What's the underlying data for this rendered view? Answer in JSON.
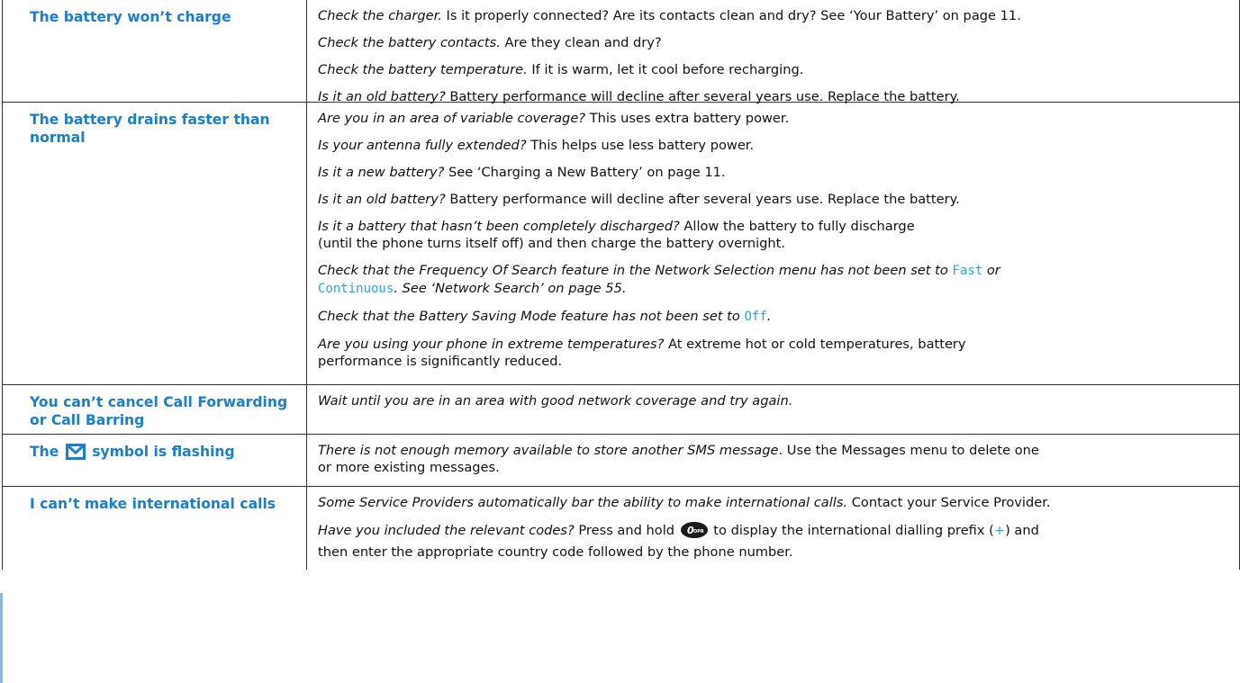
{
  "rows": [
    {
      "problem": "The battery won’t charge",
      "items": [
        {
          "lead": "Check the charger.",
          "text": " Is it properly connected? Are its contacts clean and dry? See ‘Your Battery’ on page 11."
        },
        {
          "lead": "Check the battery contacts.",
          "text": " Are they clean and dry?"
        },
        {
          "lead": "Check the battery temperature.",
          "text": " If it is warm, let it cool before recharging."
        },
        {
          "lead": "Is it an old battery?",
          "text": " Battery performance will decline after several years use. Replace the battery."
        }
      ]
    },
    {
      "problem": "The battery drains faster than normal",
      "items": [
        {
          "lead": "Are you in an area of variable coverage?",
          "text": " This uses extra battery power."
        },
        {
          "lead": "Is your antenna fully extended?",
          "text": " This helps use less battery power."
        },
        {
          "lead": "Is it a new battery?",
          "text": " See ‘Charging a New Battery’ on page 11."
        },
        {
          "lead": "Is it an old battery?",
          "text": " Battery performance will decline after several years use. Replace the battery."
        },
        {
          "lead": "Is it a battery that hasn’t been completely discharged?",
          "text": " Allow the battery to fully discharge",
          "text2": "(until the phone turns itself off) and then charge the battery overnight."
        },
        {
          "lead": "Check that the Frequency Of Search feature in the Network Selection menu has not been set to",
          "menu1": "Fast",
          "lead2": "or",
          "menu2": "Continuous",
          "lead3": ". See ‘Network Search’ on page 55."
        },
        {
          "lead": "Check that the Battery Saving Mode feature has not been set to",
          "menu1": "Off",
          "lead2": "."
        },
        {
          "lead": "Are you using your phone in extreme temperatures?",
          "text": " At extreme hot or cold temperatures, battery",
          "text2": "performance is significantly reduced."
        }
      ]
    },
    {
      "problem": "You can’t cancel Call Forwarding or Call Barring",
      "items": [
        {
          "lead": "Wait until you are in an area with good network coverage and try again."
        }
      ]
    },
    {
      "problem_before": "The",
      "problem_icon": "envelope-icon",
      "problem_after": "symbol is flashing",
      "items": [
        {
          "lead": "There is not enough memory available to store another SMS message",
          "text": ". Use the Messages menu to delete one",
          "text2": "or more existing messages."
        }
      ]
    },
    {
      "problem": "I can’t make international calls",
      "items": [
        {
          "lead": "Some Service Providers automatically bar the ability to make international calls.",
          "text": " Contact your Service Provider."
        },
        {
          "lead": "Have you included the relevant codes?",
          "text": " Press and hold",
          "key_icon": "zero-opr-key-icon",
          "text_after_key": " to display the international dialling prefix (",
          "plus": "+",
          "text_after_plus": ") and",
          "text2": "then enter the appropriate country code followed by the phone number."
        }
      ]
    }
  ],
  "colors": {
    "heading": "#1a7fd0",
    "menu_text": "#2aa4e6",
    "border": "#333333"
  }
}
